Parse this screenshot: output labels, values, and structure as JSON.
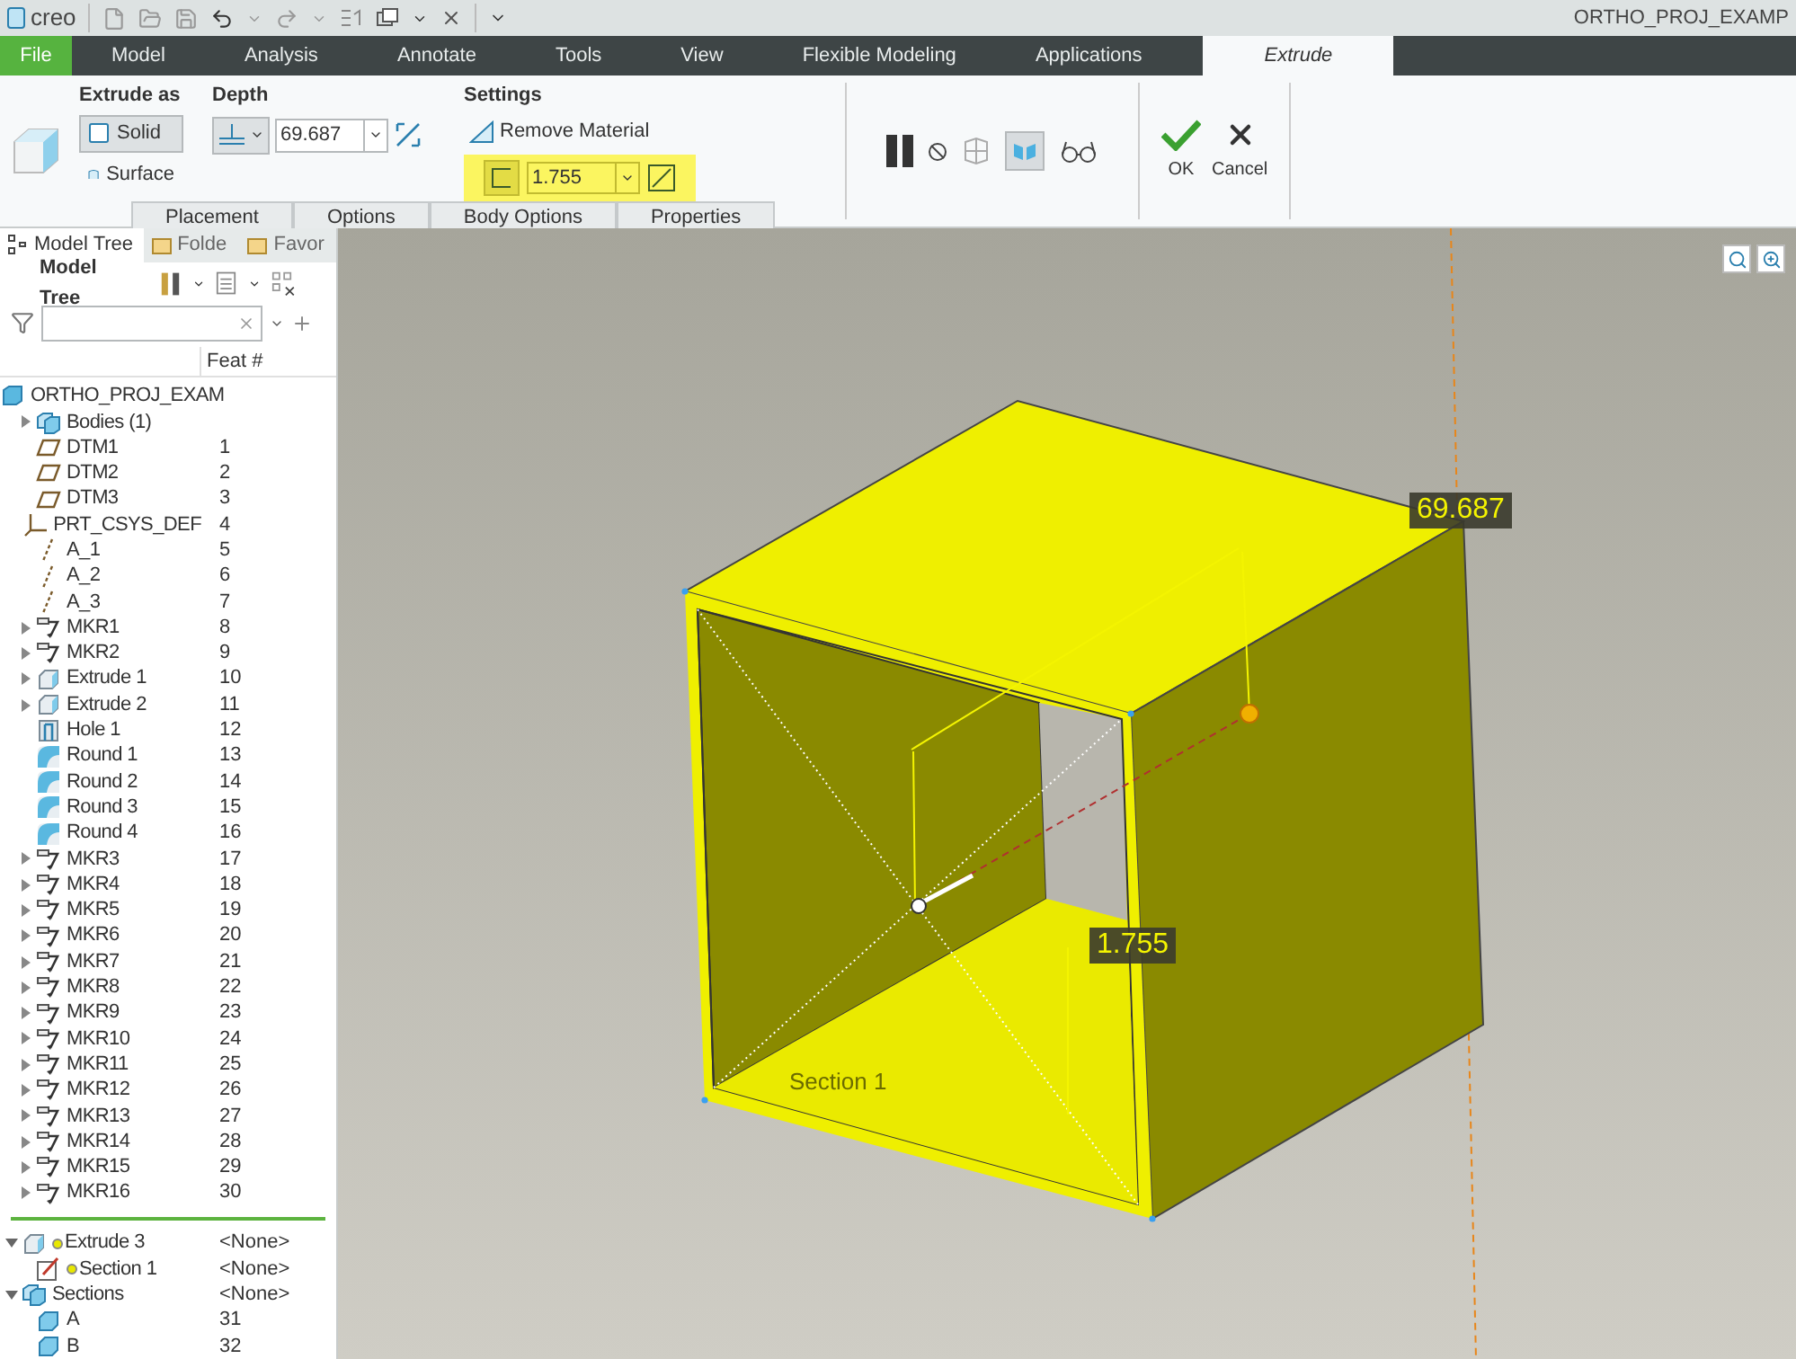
{
  "window": {
    "app_name": "creo",
    "title": "ORTHO_PROJ_EXAMP"
  },
  "tabs": [
    {
      "label": "File",
      "kind": "file",
      "selected": false
    },
    {
      "label": "Model",
      "kind": "tab",
      "selected": false
    },
    {
      "label": "Analysis",
      "kind": "tab",
      "selected": false
    },
    {
      "label": "Annotate",
      "kind": "tab",
      "selected": false
    },
    {
      "label": "Tools",
      "kind": "tab",
      "selected": false
    },
    {
      "label": "View",
      "kind": "tab",
      "selected": false
    },
    {
      "label": "Flexible Modeling",
      "kind": "tab",
      "selected": false
    },
    {
      "label": "Applications",
      "kind": "tab",
      "selected": false
    },
    {
      "label": "Extrude",
      "kind": "tab",
      "selected": true
    }
  ],
  "ribbon": {
    "extrude_as": {
      "label": "Extrude as",
      "options": [
        {
          "label": "Solid",
          "selected": true
        },
        {
          "label": "Surface",
          "selected": false
        }
      ]
    },
    "depth": {
      "label": "Depth",
      "value": "69.687"
    },
    "settings": {
      "label": "Settings",
      "remove_material": {
        "label": "Remove Material",
        "checked": false
      },
      "thickness": {
        "value": "1.755",
        "on": true
      }
    },
    "panel_tabs": [
      "Placement",
      "Options",
      "Body Options",
      "Properties"
    ],
    "pause": {
      "paused": false
    },
    "preview": {
      "selected": true
    },
    "ok": "OK",
    "cancel": "Cancel"
  },
  "sidebar": {
    "tabs": [
      {
        "label": "Model Tree",
        "selected": true
      },
      {
        "label": "Folde",
        "selected": false
      },
      {
        "label": "Favor",
        "selected": false
      }
    ],
    "toolbar_title": "Model Tree",
    "column": "Feat #",
    "tree": {
      "label": "ORTHO_PROJ_EXAM",
      "kind": "part",
      "children": [
        {
          "label": "Bodies (1)",
          "kind": "bodies",
          "expanded": false
        },
        {
          "label": "DTM1",
          "feat": "1",
          "kind": "plane"
        },
        {
          "label": "DTM2",
          "feat": "2",
          "kind": "plane"
        },
        {
          "label": "DTM3",
          "feat": "3",
          "kind": "plane"
        },
        {
          "label": "PRT_CSYS_DEF",
          "feat": "4",
          "kind": "csys"
        },
        {
          "label": "A_1",
          "feat": "5",
          "kind": "axis"
        },
        {
          "label": "A_2",
          "feat": "6",
          "kind": "axis"
        },
        {
          "label": "A_3",
          "feat": "7",
          "kind": "axis"
        },
        {
          "label": "MKR1",
          "feat": "8",
          "kind": "marker",
          "expanded": false
        },
        {
          "label": "MKR2",
          "feat": "9",
          "kind": "marker",
          "expanded": false
        },
        {
          "label": "Extrude 1",
          "feat": "10",
          "kind": "extrude",
          "expanded": false
        },
        {
          "label": "Extrude 2",
          "feat": "11",
          "kind": "extrude",
          "expanded": false
        },
        {
          "label": "Hole 1",
          "feat": "12",
          "kind": "hole"
        },
        {
          "label": "Round 1",
          "feat": "13",
          "kind": "round"
        },
        {
          "label": "Round 2",
          "feat": "14",
          "kind": "round"
        },
        {
          "label": "Round 3",
          "feat": "15",
          "kind": "round"
        },
        {
          "label": "Round 4",
          "feat": "16",
          "kind": "round"
        },
        {
          "label": "MKR3",
          "feat": "17",
          "kind": "marker",
          "expanded": false
        },
        {
          "label": "MKR4",
          "feat": "18",
          "kind": "marker",
          "expanded": false
        },
        {
          "label": "MKR5",
          "feat": "19",
          "kind": "marker",
          "expanded": false
        },
        {
          "label": "MKR6",
          "feat": "20",
          "kind": "marker",
          "expanded": false
        },
        {
          "label": "MKR7",
          "feat": "21",
          "kind": "marker",
          "expanded": false
        },
        {
          "label": "MKR8",
          "feat": "22",
          "kind": "marker",
          "expanded": false
        },
        {
          "label": "MKR9",
          "feat": "23",
          "kind": "marker",
          "expanded": false
        },
        {
          "label": "MKR10",
          "feat": "24",
          "kind": "marker",
          "expanded": false
        },
        {
          "label": "MKR11",
          "feat": "25",
          "kind": "marker",
          "expanded": false
        },
        {
          "label": "MKR12",
          "feat": "26",
          "kind": "marker",
          "expanded": false
        },
        {
          "label": "MKR13",
          "feat": "27",
          "kind": "marker",
          "expanded": false
        },
        {
          "label": "MKR14",
          "feat": "28",
          "kind": "marker",
          "expanded": false
        },
        {
          "label": "MKR15",
          "feat": "29",
          "kind": "marker",
          "expanded": false
        },
        {
          "label": "MKR16",
          "feat": "30",
          "kind": "marker",
          "expanded": false
        }
      ]
    },
    "insert_items": [
      {
        "label": "Extrude 3",
        "feat": "<None>",
        "kind": "extrude",
        "new": true,
        "expanded": true,
        "children": [
          {
            "label": "Section 1",
            "feat": "<None>",
            "kind": "sketch",
            "new": true
          }
        ]
      },
      {
        "label": "Sections",
        "feat": "<None>",
        "kind": "bodies",
        "expanded": true,
        "children": [
          {
            "label": "A",
            "feat": "31",
            "kind": "body"
          },
          {
            "label": "B",
            "feat": "32",
            "kind": "body"
          }
        ]
      }
    ]
  },
  "viewport": {
    "depth_label": "69.687",
    "thickness_label": "1.755",
    "section_label": "Section 1"
  }
}
